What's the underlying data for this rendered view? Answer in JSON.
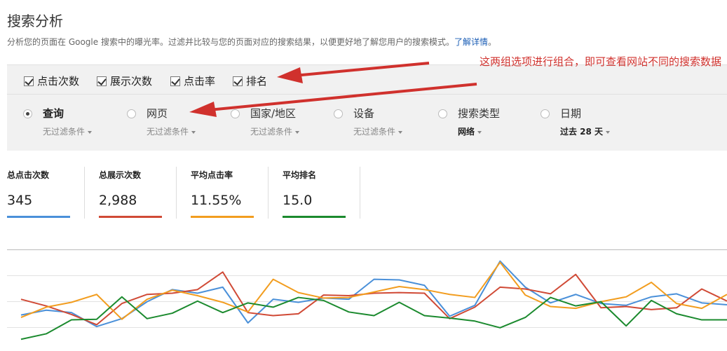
{
  "header": {
    "title": "搜索分析",
    "subtitle": "分析您的页面在 Google 搜索中的曝光率。过滤并比较与您的页面对应的搜索结果，以便更好地了解您用户的搜索模式。",
    "learn_more": "了解详情",
    "subtitle_end": "。"
  },
  "metric_toggles": [
    {
      "label": "点击次数",
      "checked": true
    },
    {
      "label": "展示次数",
      "checked": true
    },
    {
      "label": "点击率",
      "checked": true
    },
    {
      "label": "排名",
      "checked": true
    }
  ],
  "dimensions": [
    {
      "label": "查询",
      "selected": true,
      "filter": "无过滤条件",
      "filter_bold": false
    },
    {
      "label": "网页",
      "selected": false,
      "filter": "无过滤条件",
      "filter_bold": false
    },
    {
      "label": "国家/地区",
      "selected": false,
      "filter": "无过滤条件",
      "filter_bold": false
    },
    {
      "label": "设备",
      "selected": false,
      "filter": "无过滤条件",
      "filter_bold": false
    },
    {
      "label": "搜索类型",
      "selected": false,
      "filter": "网络",
      "filter_bold": true
    },
    {
      "label": "日期",
      "selected": false,
      "filter": "过去 28 天",
      "filter_bold": true
    }
  ],
  "annotation": "这两组选项进行组合，即可查看网站不同的搜索数据",
  "annotation_color": "#d0312d",
  "scorecards": [
    {
      "label": "总点击次数",
      "value": "345",
      "color": "#4a90d9"
    },
    {
      "label": "总展示次数",
      "value": "2,988",
      "color": "#d04a36"
    },
    {
      "label": "平均点击率",
      "value": "11.55%",
      "color": "#f29d1f"
    },
    {
      "label": "平均排名",
      "value": "15.0",
      "color": "#1b8a2e"
    }
  ],
  "chart_data": {
    "type": "line",
    "title": "",
    "xlabel": "",
    "ylabel": "",
    "grid": true,
    "x": [
      1,
      2,
      3,
      4,
      5,
      6,
      7,
      8,
      9,
      10,
      11,
      12,
      13,
      14,
      15,
      16,
      17,
      18,
      19,
      20,
      21,
      22,
      23,
      24,
      25,
      26,
      27,
      28,
      29
    ],
    "series": [
      {
        "name": "点击次数",
        "color": "#4a90d9",
        "values": [
          24,
          32,
          28,
          5,
          18,
          46,
          66,
          60,
          70,
          11,
          50,
          45,
          52,
          50,
          83,
          82,
          73,
          22,
          40,
          113,
          70,
          44,
          58,
          43,
          40,
          54,
          59,
          44,
          41
        ]
      },
      {
        "name": "展示次数",
        "color": "#d04a36",
        "values": [
          50,
          39,
          25,
          8,
          43,
          58,
          60,
          66,
          95,
          28,
          23,
          26,
          57,
          56,
          60,
          61,
          60,
          18,
          37,
          70,
          67,
          59,
          91,
          36,
          38,
          33,
          36,
          67,
          47
        ]
      },
      {
        "name": "点击率",
        "color": "#f29d1f",
        "values": [
          20,
          37,
          45,
          58,
          17,
          50,
          65,
          56,
          45,
          29,
          83,
          61,
          52,
          53,
          62,
          71,
          66,
          58,
          53,
          111,
          57,
          38,
          35,
          46,
          54,
          78,
          43,
          35,
          58
        ]
      },
      {
        "name": "排名",
        "color": "#1b8a2e",
        "values": [
          -16,
          -7,
          16,
          17,
          54,
          18,
          27,
          47,
          28,
          44,
          37,
          53,
          48,
          29,
          23,
          45,
          23,
          19,
          14,
          3,
          20,
          53,
          39,
          46,
          6,
          48,
          26,
          16,
          16
        ]
      }
    ]
  }
}
